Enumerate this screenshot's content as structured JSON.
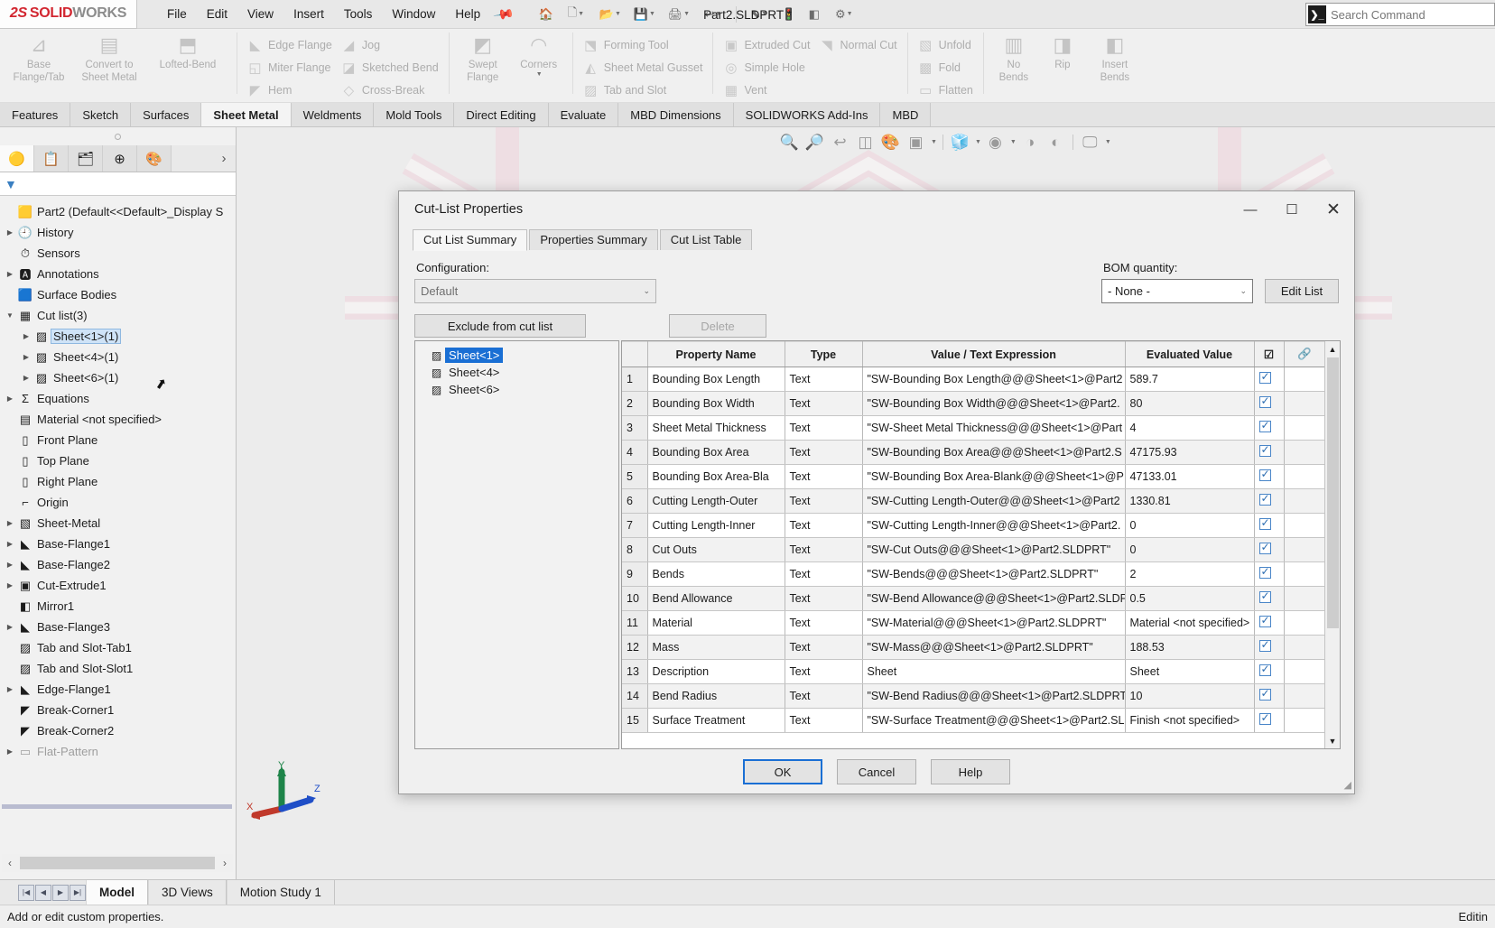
{
  "app": {
    "brand_ds": "2S",
    "brand_solid": "SOLID",
    "brand_works": "WORKS",
    "document_title": "Part2.SLDPRT *",
    "search_placeholder": "Search Command"
  },
  "menubar": {
    "items": [
      {
        "label": "File"
      },
      {
        "label": "Edit"
      },
      {
        "label": "View"
      },
      {
        "label": "Insert"
      },
      {
        "label": "Tools"
      },
      {
        "label": "Window"
      },
      {
        "label": "Help"
      }
    ],
    "pin": "pin-icon"
  },
  "quick_access": {
    "items": [
      {
        "name": "new-document-icon",
        "glyph": "🗋"
      },
      {
        "name": "open-icon",
        "glyph": "📂"
      },
      {
        "name": "save-icon",
        "glyph": "💾"
      },
      {
        "name": "print-icon",
        "glyph": "🖨"
      },
      {
        "name": "undo-icon",
        "glyph": "↩"
      },
      {
        "name": "redo-icon",
        "glyph": "↪"
      },
      {
        "name": "select-icon",
        "glyph": "⬉"
      },
      {
        "name": "rebuild-icon",
        "glyph": "🚦"
      },
      {
        "name": "options-icon",
        "glyph": "⚙"
      }
    ]
  },
  "ribbon": {
    "groups": [
      {
        "name": "base-flange-group",
        "big_buttons": [
          {
            "label": "Base\nFlange/Tab",
            "icon": "base-flange-icon",
            "glyph": "⊿"
          },
          {
            "label": "Convert to\nSheet Metal",
            "icon": "convert-sheet-metal-icon",
            "glyph": "▤"
          },
          {
            "label": "Lofted-Bend",
            "icon": "lofted-bend-icon",
            "glyph": "⬒"
          }
        ]
      },
      {
        "name": "flange-commands-group",
        "items": [
          {
            "label": "Edge Flange",
            "icon": "edge-flange-icon",
            "glyph": "◣"
          },
          {
            "label": "Miter Flange",
            "icon": "miter-flange-icon",
            "glyph": "◱"
          },
          {
            "label": "Hem",
            "icon": "hem-icon",
            "glyph": "◤"
          },
          {
            "label": "Jog",
            "icon": "jog-icon",
            "glyph": "◢"
          },
          {
            "label": "Sketched Bend",
            "icon": "sketched-bend-icon",
            "glyph": "◪"
          },
          {
            "label": "Cross-Break",
            "icon": "cross-break-icon",
            "glyph": "◇"
          }
        ]
      },
      {
        "name": "swept-flange-group",
        "big_buttons": [
          {
            "label": "Swept\nFlange",
            "icon": "swept-flange-icon",
            "glyph": "◩"
          },
          {
            "label": "Corners",
            "icon": "corners-icon",
            "glyph": "◠"
          }
        ]
      },
      {
        "name": "forming-group",
        "items": [
          {
            "label": "Forming Tool",
            "icon": "forming-tool-icon",
            "glyph": "⬔"
          },
          {
            "label": "Sheet Metal Gusset",
            "icon": "sheet-metal-gusset-icon",
            "glyph": "◭"
          },
          {
            "label": "Tab and Slot",
            "icon": "tab-and-slot-icon",
            "glyph": "▨"
          }
        ]
      },
      {
        "name": "cut-group",
        "items": [
          {
            "label": "Extruded Cut",
            "icon": "extruded-cut-icon",
            "glyph": "▣"
          },
          {
            "label": "Simple Hole",
            "icon": "simple-hole-icon",
            "glyph": "◎"
          },
          {
            "label": "Vent",
            "icon": "vent-icon",
            "glyph": "▦"
          },
          {
            "label": "Normal Cut",
            "icon": "normal-cut-icon",
            "glyph": "◥"
          }
        ]
      },
      {
        "name": "fold-group",
        "items": [
          {
            "label": "Unfold",
            "icon": "unfold-icon",
            "glyph": "▧"
          },
          {
            "label": "Fold",
            "icon": "fold-icon",
            "glyph": "▩"
          },
          {
            "label": "Flatten",
            "icon": "flatten-icon",
            "glyph": "▭"
          }
        ]
      },
      {
        "name": "bends-group",
        "big_buttons": [
          {
            "label": "No\nBends",
            "icon": "no-bends-icon",
            "glyph": "▥"
          },
          {
            "label": "Rip",
            "icon": "rip-icon",
            "glyph": "◨"
          },
          {
            "label": "Insert\nBends",
            "icon": "insert-bends-icon",
            "glyph": "◧"
          }
        ]
      }
    ]
  },
  "command_tabs": {
    "items": [
      {
        "label": "Features",
        "active": false
      },
      {
        "label": "Sketch",
        "active": false
      },
      {
        "label": "Surfaces",
        "active": false
      },
      {
        "label": "Sheet Metal",
        "active": true
      },
      {
        "label": "Weldments",
        "active": false
      },
      {
        "label": "Mold Tools",
        "active": false
      },
      {
        "label": "Direct Editing",
        "active": false
      },
      {
        "label": "Evaluate",
        "active": false
      },
      {
        "label": "MBD Dimensions",
        "active": false
      },
      {
        "label": "SOLIDWORKS Add-Ins",
        "active": false
      },
      {
        "label": "MBD",
        "active": false
      }
    ]
  },
  "feature_panel": {
    "tabs": [
      {
        "name": "feature-manager-tab",
        "glyph": "🟡",
        "active": true
      },
      {
        "name": "property-manager-tab",
        "glyph": "📋",
        "active": false
      },
      {
        "name": "configuration-manager-tab",
        "glyph": "🗂",
        "active": false
      },
      {
        "name": "dimxpert-manager-tab",
        "glyph": "⊕",
        "active": false
      },
      {
        "name": "display-manager-tab",
        "glyph": "🎨",
        "active": false
      }
    ],
    "expand_arrow": "chevron-right-icon",
    "filter_icon": "filter-funnel-icon",
    "tree": [
      {
        "label": "Part2  (Default<<Default>_Display S",
        "icon": "part-icon",
        "glyph": "🟨",
        "indent": 0,
        "expandable": false,
        "selected": false,
        "dim": false
      },
      {
        "label": "History",
        "icon": "history-icon",
        "glyph": "🕘",
        "indent": 1,
        "expandable": true,
        "selected": false,
        "dim": false
      },
      {
        "label": "Sensors",
        "icon": "sensors-icon",
        "glyph": "⏱",
        "indent": 1,
        "expandable": false,
        "selected": false,
        "dim": false
      },
      {
        "label": "Annotations",
        "icon": "annotations-icon",
        "glyph": "🅰",
        "indent": 1,
        "expandable": true,
        "selected": false,
        "dim": false
      },
      {
        "label": "Surface Bodies",
        "icon": "surface-bodies-icon",
        "glyph": "🟦",
        "indent": 1,
        "expandable": false,
        "selected": false,
        "dim": false
      },
      {
        "label": "Cut list(3)",
        "icon": "cut-list-icon",
        "glyph": "▦",
        "indent": 1,
        "expandable": true,
        "expanded": true,
        "selected": false,
        "dim": false
      },
      {
        "label": "Sheet<1>(1)",
        "icon": "sheet-body-icon",
        "glyph": "▨",
        "indent": 2,
        "expandable": true,
        "selected": true,
        "dim": false
      },
      {
        "label": "Sheet<4>(1)",
        "icon": "sheet-body-icon",
        "glyph": "▨",
        "indent": 2,
        "expandable": true,
        "selected": false,
        "dim": false
      },
      {
        "label": "Sheet<6>(1)",
        "icon": "sheet-body-icon",
        "glyph": "▨",
        "indent": 2,
        "expandable": true,
        "selected": false,
        "dim": false
      },
      {
        "label": "Equations",
        "icon": "equations-icon",
        "glyph": "Σ",
        "indent": 1,
        "expandable": true,
        "selected": false,
        "dim": false
      },
      {
        "label": "Material <not specified>",
        "icon": "material-icon",
        "glyph": "▤",
        "indent": 1,
        "expandable": false,
        "selected": false,
        "dim": false
      },
      {
        "label": "Front Plane",
        "icon": "plane-icon",
        "glyph": "▯",
        "indent": 1,
        "expandable": false,
        "selected": false,
        "dim": false
      },
      {
        "label": "Top Plane",
        "icon": "plane-icon",
        "glyph": "▯",
        "indent": 1,
        "expandable": false,
        "selected": false,
        "dim": false
      },
      {
        "label": "Right Plane",
        "icon": "plane-icon",
        "glyph": "▯",
        "indent": 1,
        "expandable": false,
        "selected": false,
        "dim": false
      },
      {
        "label": "Origin",
        "icon": "origin-icon",
        "glyph": "⌐",
        "indent": 1,
        "expandable": false,
        "selected": false,
        "dim": false
      },
      {
        "label": "Sheet-Metal",
        "icon": "sheet-metal-icon",
        "glyph": "▧",
        "indent": 1,
        "expandable": true,
        "selected": false,
        "dim": false
      },
      {
        "label": "Base-Flange1",
        "icon": "base-flange-icon",
        "glyph": "◣",
        "indent": 1,
        "expandable": true,
        "selected": false,
        "dim": false
      },
      {
        "label": "Base-Flange2",
        "icon": "base-flange-icon",
        "glyph": "◣",
        "indent": 1,
        "expandable": true,
        "selected": false,
        "dim": false
      },
      {
        "label": "Cut-Extrude1",
        "icon": "cut-extrude-icon",
        "glyph": "▣",
        "indent": 1,
        "expandable": true,
        "selected": false,
        "dim": false
      },
      {
        "label": "Mirror1",
        "icon": "mirror-icon",
        "glyph": "◧",
        "indent": 1,
        "expandable": false,
        "selected": false,
        "dim": false
      },
      {
        "label": "Base-Flange3",
        "icon": "base-flange-icon",
        "glyph": "◣",
        "indent": 1,
        "expandable": true,
        "selected": false,
        "dim": false
      },
      {
        "label": "Tab and Slot-Tab1",
        "icon": "tab-and-slot-icon",
        "glyph": "▨",
        "indent": 1,
        "expandable": false,
        "selected": false,
        "dim": false
      },
      {
        "label": "Tab and Slot-Slot1",
        "icon": "tab-and-slot-icon",
        "glyph": "▨",
        "indent": 1,
        "expandable": false,
        "selected": false,
        "dim": false
      },
      {
        "label": "Edge-Flange1",
        "icon": "edge-flange-icon",
        "glyph": "◣",
        "indent": 1,
        "expandable": true,
        "selected": false,
        "dim": false
      },
      {
        "label": "Break-Corner1",
        "icon": "break-corner-icon",
        "glyph": "◤",
        "indent": 1,
        "expandable": false,
        "selected": false,
        "dim": false
      },
      {
        "label": "Break-Corner2",
        "icon": "break-corner-icon",
        "glyph": "◤",
        "indent": 1,
        "expandable": false,
        "selected": false,
        "dim": false
      },
      {
        "label": "Flat-Pattern",
        "icon": "flat-pattern-icon",
        "glyph": "▭",
        "indent": 1,
        "expandable": true,
        "selected": false,
        "dim": true
      }
    ]
  },
  "view_toolbar": {
    "items": [
      {
        "name": "zoom-to-fit-icon",
        "glyph": "🔍"
      },
      {
        "name": "zoom-to-area-icon",
        "glyph": "🔎"
      },
      {
        "name": "previous-view-icon",
        "glyph": "↩"
      },
      {
        "name": "section-view-icon",
        "glyph": "◫"
      },
      {
        "name": "view-orientation-icon",
        "glyph": "🎨"
      },
      {
        "name": "display-style-icon",
        "glyph": "▣"
      },
      {
        "name": "hide-show-items-icon",
        "glyph": "◉"
      },
      {
        "name": "apply-scene-icon",
        "glyph": "◑"
      },
      {
        "name": "view-settings-icon",
        "glyph": "◐"
      },
      {
        "name": "viewport-icon",
        "glyph": "🖵"
      }
    ]
  },
  "dialog": {
    "title": "Cut-List Properties",
    "window_controls": [
      {
        "name": "minimize-button",
        "glyph": "—"
      },
      {
        "name": "maximize-button",
        "glyph": "☐"
      },
      {
        "name": "close-button",
        "glyph": "✕"
      }
    ],
    "tabs": [
      {
        "label": "Cut List Summary",
        "active": true
      },
      {
        "label": "Properties Summary",
        "active": false
      },
      {
        "label": "Cut List Table",
        "active": false
      }
    ],
    "configuration_label": "Configuration:",
    "configuration_value": "Default",
    "bom_label": "BOM quantity:",
    "bom_value": "- None -",
    "edit_list_label": "Edit List",
    "exclude_label": "Exclude from cut list",
    "delete_label": "Delete",
    "sheet_list": [
      {
        "label": "Sheet<1>",
        "selected": true
      },
      {
        "label": "Sheet<4>",
        "selected": false
      },
      {
        "label": "Sheet<6>",
        "selected": false
      }
    ],
    "table": {
      "headers": [
        "",
        "Property Name",
        "Type",
        "Value / Text Expression",
        "Evaluated Value",
        "☑",
        "🔗"
      ],
      "rows": [
        {
          "n": "1",
          "name": "Bounding Box Length",
          "type": "Text",
          "value": "\"SW-Bounding Box Length@@@Sheet<1>@Part2",
          "evaluated": "589.7",
          "checked": true
        },
        {
          "n": "2",
          "name": "Bounding Box Width",
          "type": "Text",
          "value": "\"SW-Bounding Box Width@@@Sheet<1>@Part2.",
          "evaluated": "80",
          "checked": true
        },
        {
          "n": "3",
          "name": "Sheet Metal Thickness",
          "type": "Text",
          "value": "\"SW-Sheet Metal Thickness@@@Sheet<1>@Part",
          "evaluated": "4",
          "checked": true
        },
        {
          "n": "4",
          "name": "Bounding Box Area",
          "type": "Text",
          "value": "\"SW-Bounding Box Area@@@Sheet<1>@Part2.S",
          "evaluated": "47175.93",
          "checked": true
        },
        {
          "n": "5",
          "name": "Bounding Box Area-Bla",
          "type": "Text",
          "value": "\"SW-Bounding Box Area-Blank@@@Sheet<1>@P",
          "evaluated": "47133.01",
          "checked": true
        },
        {
          "n": "6",
          "name": "Cutting Length-Outer",
          "type": "Text",
          "value": "\"SW-Cutting Length-Outer@@@Sheet<1>@Part2",
          "evaluated": "1330.81",
          "checked": true
        },
        {
          "n": "7",
          "name": "Cutting Length-Inner",
          "type": "Text",
          "value": "\"SW-Cutting Length-Inner@@@Sheet<1>@Part2.",
          "evaluated": "0",
          "checked": true
        },
        {
          "n": "8",
          "name": "Cut Outs",
          "type": "Text",
          "value": "\"SW-Cut Outs@@@Sheet<1>@Part2.SLDPRT\"",
          "evaluated": "0",
          "checked": true
        },
        {
          "n": "9",
          "name": "Bends",
          "type": "Text",
          "value": "\"SW-Bends@@@Sheet<1>@Part2.SLDPRT\"",
          "evaluated": "2",
          "checked": true
        },
        {
          "n": "10",
          "name": "Bend Allowance",
          "type": "Text",
          "value": "\"SW-Bend Allowance@@@Sheet<1>@Part2.SLDP",
          "evaluated": "0.5",
          "checked": true
        },
        {
          "n": "11",
          "name": "Material",
          "type": "Text",
          "value": "\"SW-Material@@@Sheet<1>@Part2.SLDPRT\"",
          "evaluated": "Material <not specified>",
          "checked": true
        },
        {
          "n": "12",
          "name": "Mass",
          "type": "Text",
          "value": "\"SW-Mass@@@Sheet<1>@Part2.SLDPRT\"",
          "evaluated": "188.53",
          "checked": true
        },
        {
          "n": "13",
          "name": "Description",
          "type": "Text",
          "value": "Sheet",
          "evaluated": "Sheet",
          "checked": true
        },
        {
          "n": "14",
          "name": "Bend Radius",
          "type": "Text",
          "value": "\"SW-Bend Radius@@@Sheet<1>@Part2.SLDPRT\"",
          "evaluated": "10",
          "checked": true
        },
        {
          "n": "15",
          "name": "Surface Treatment",
          "type": "Text",
          "value": "\"SW-Surface Treatment@@@Sheet<1>@Part2.SL",
          "evaluated": "Finish <not specified>",
          "checked": true
        }
      ]
    },
    "footer": {
      "ok_label": "OK",
      "cancel_label": "Cancel",
      "help_label": "Help"
    }
  },
  "bottom_tabs": {
    "nav_buttons": [
      {
        "name": "first-tab-button",
        "glyph": "|◀"
      },
      {
        "name": "previous-tab-button",
        "glyph": "◀"
      },
      {
        "name": "next-tab-button",
        "glyph": "▶"
      },
      {
        "name": "last-tab-button",
        "glyph": "▶|"
      }
    ],
    "tabs": [
      {
        "label": "Model",
        "active": true
      },
      {
        "label": "3D Views",
        "active": false
      },
      {
        "label": "Motion Study 1",
        "active": false
      }
    ]
  },
  "status_bar": {
    "message": "Add or edit custom properties.",
    "right_text": "Editin"
  }
}
